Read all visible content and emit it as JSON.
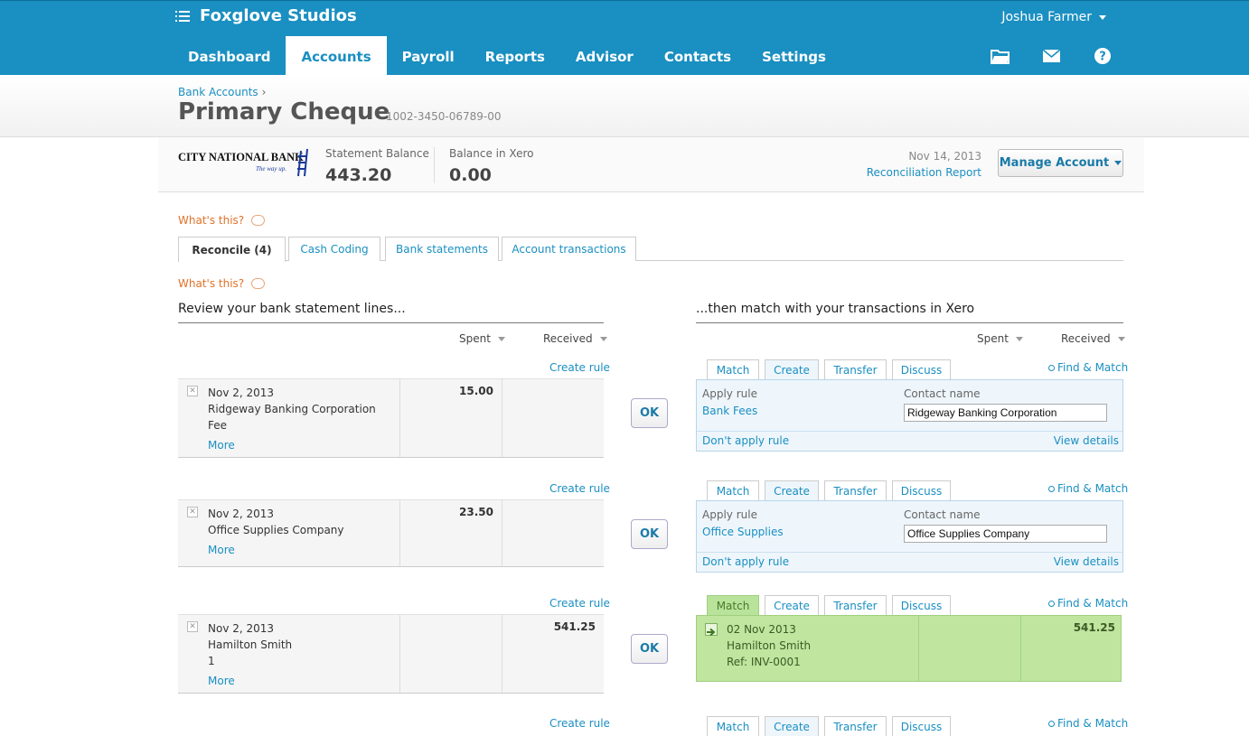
{
  "app": {
    "org_name": "Foxglove Studios",
    "user_name": "Joshua Farmer"
  },
  "nav": [
    "Dashboard",
    "Accounts",
    "Payroll",
    "Reports",
    "Advisor",
    "Contacts",
    "Settings"
  ],
  "nav_active": "Accounts",
  "icons": [
    "menu-icon",
    "folder-icon",
    "mail-icon",
    "help-icon",
    "speech-bubble-icon",
    "search-icon",
    "remove-icon",
    "match-arrow-icon",
    "caret-down-icon"
  ],
  "header": {
    "breadcrumb": "Bank Accounts",
    "breadcrumb_sep": "›",
    "title": "Primary Cheque",
    "account_number": "1002-3450-06789-00"
  },
  "account": {
    "bank_logo_name": "CITY NATIONAL BANK",
    "bank_logo_tagline": "The way up.",
    "statement_balance_label": "Statement Balance",
    "statement_balance": "443.20",
    "xero_balance_label": "Balance in Xero",
    "xero_balance": "0.00",
    "date": "Nov 14, 2013",
    "reconciliation_report": "Reconciliation Report",
    "manage_button": "Manage Account"
  },
  "whats_this": "What's this?",
  "tabs": [
    "Reconcile (4)",
    "Cash Coding",
    "Bank statements",
    "Account transactions"
  ],
  "left": {
    "heading": "Review your bank statement lines...",
    "spent": "Spent",
    "received": "Received",
    "create_rule": "Create rule",
    "more": "More"
  },
  "right": {
    "heading": "...then match with your transactions in Xero",
    "spent": "Spent",
    "received": "Received",
    "tab_labels": [
      "Match",
      "Create",
      "Transfer",
      "Discuss"
    ],
    "find_match": "Find & Match",
    "apply_rule": "Apply rule",
    "contact_name": "Contact name",
    "dont_apply": "Don't apply rule",
    "view_details": "View details"
  },
  "ok_label": "OK",
  "lines": [
    {
      "date": "Nov 2, 2013",
      "payee": "Ridgeway Banking Corporation",
      "ref": "Fee",
      "spent": "15.00",
      "received": "",
      "mode": "create",
      "rule": "Bank Fees",
      "contact": "Ridgeway Banking Corporation"
    },
    {
      "date": "Nov 2, 2013",
      "payee": "Office Supplies Company",
      "ref": "",
      "spent": "23.50",
      "received": "",
      "mode": "create",
      "rule": "Office Supplies",
      "contact": "Office Supplies Company"
    },
    {
      "date": "Nov 2, 2013",
      "payee": "Hamilton Smith",
      "ref": "1",
      "spent": "",
      "received": "541.25",
      "mode": "match",
      "match_date": "02 Nov 2013",
      "match_payee": "Hamilton Smith",
      "match_ref": "Ref: INV-0001",
      "match_received": "541.25"
    }
  ],
  "colors": {
    "topbar": "#1a8fc1",
    "link": "#1a8fc1",
    "whats_this": "#e0722a",
    "match_green": "#bfe59f"
  }
}
